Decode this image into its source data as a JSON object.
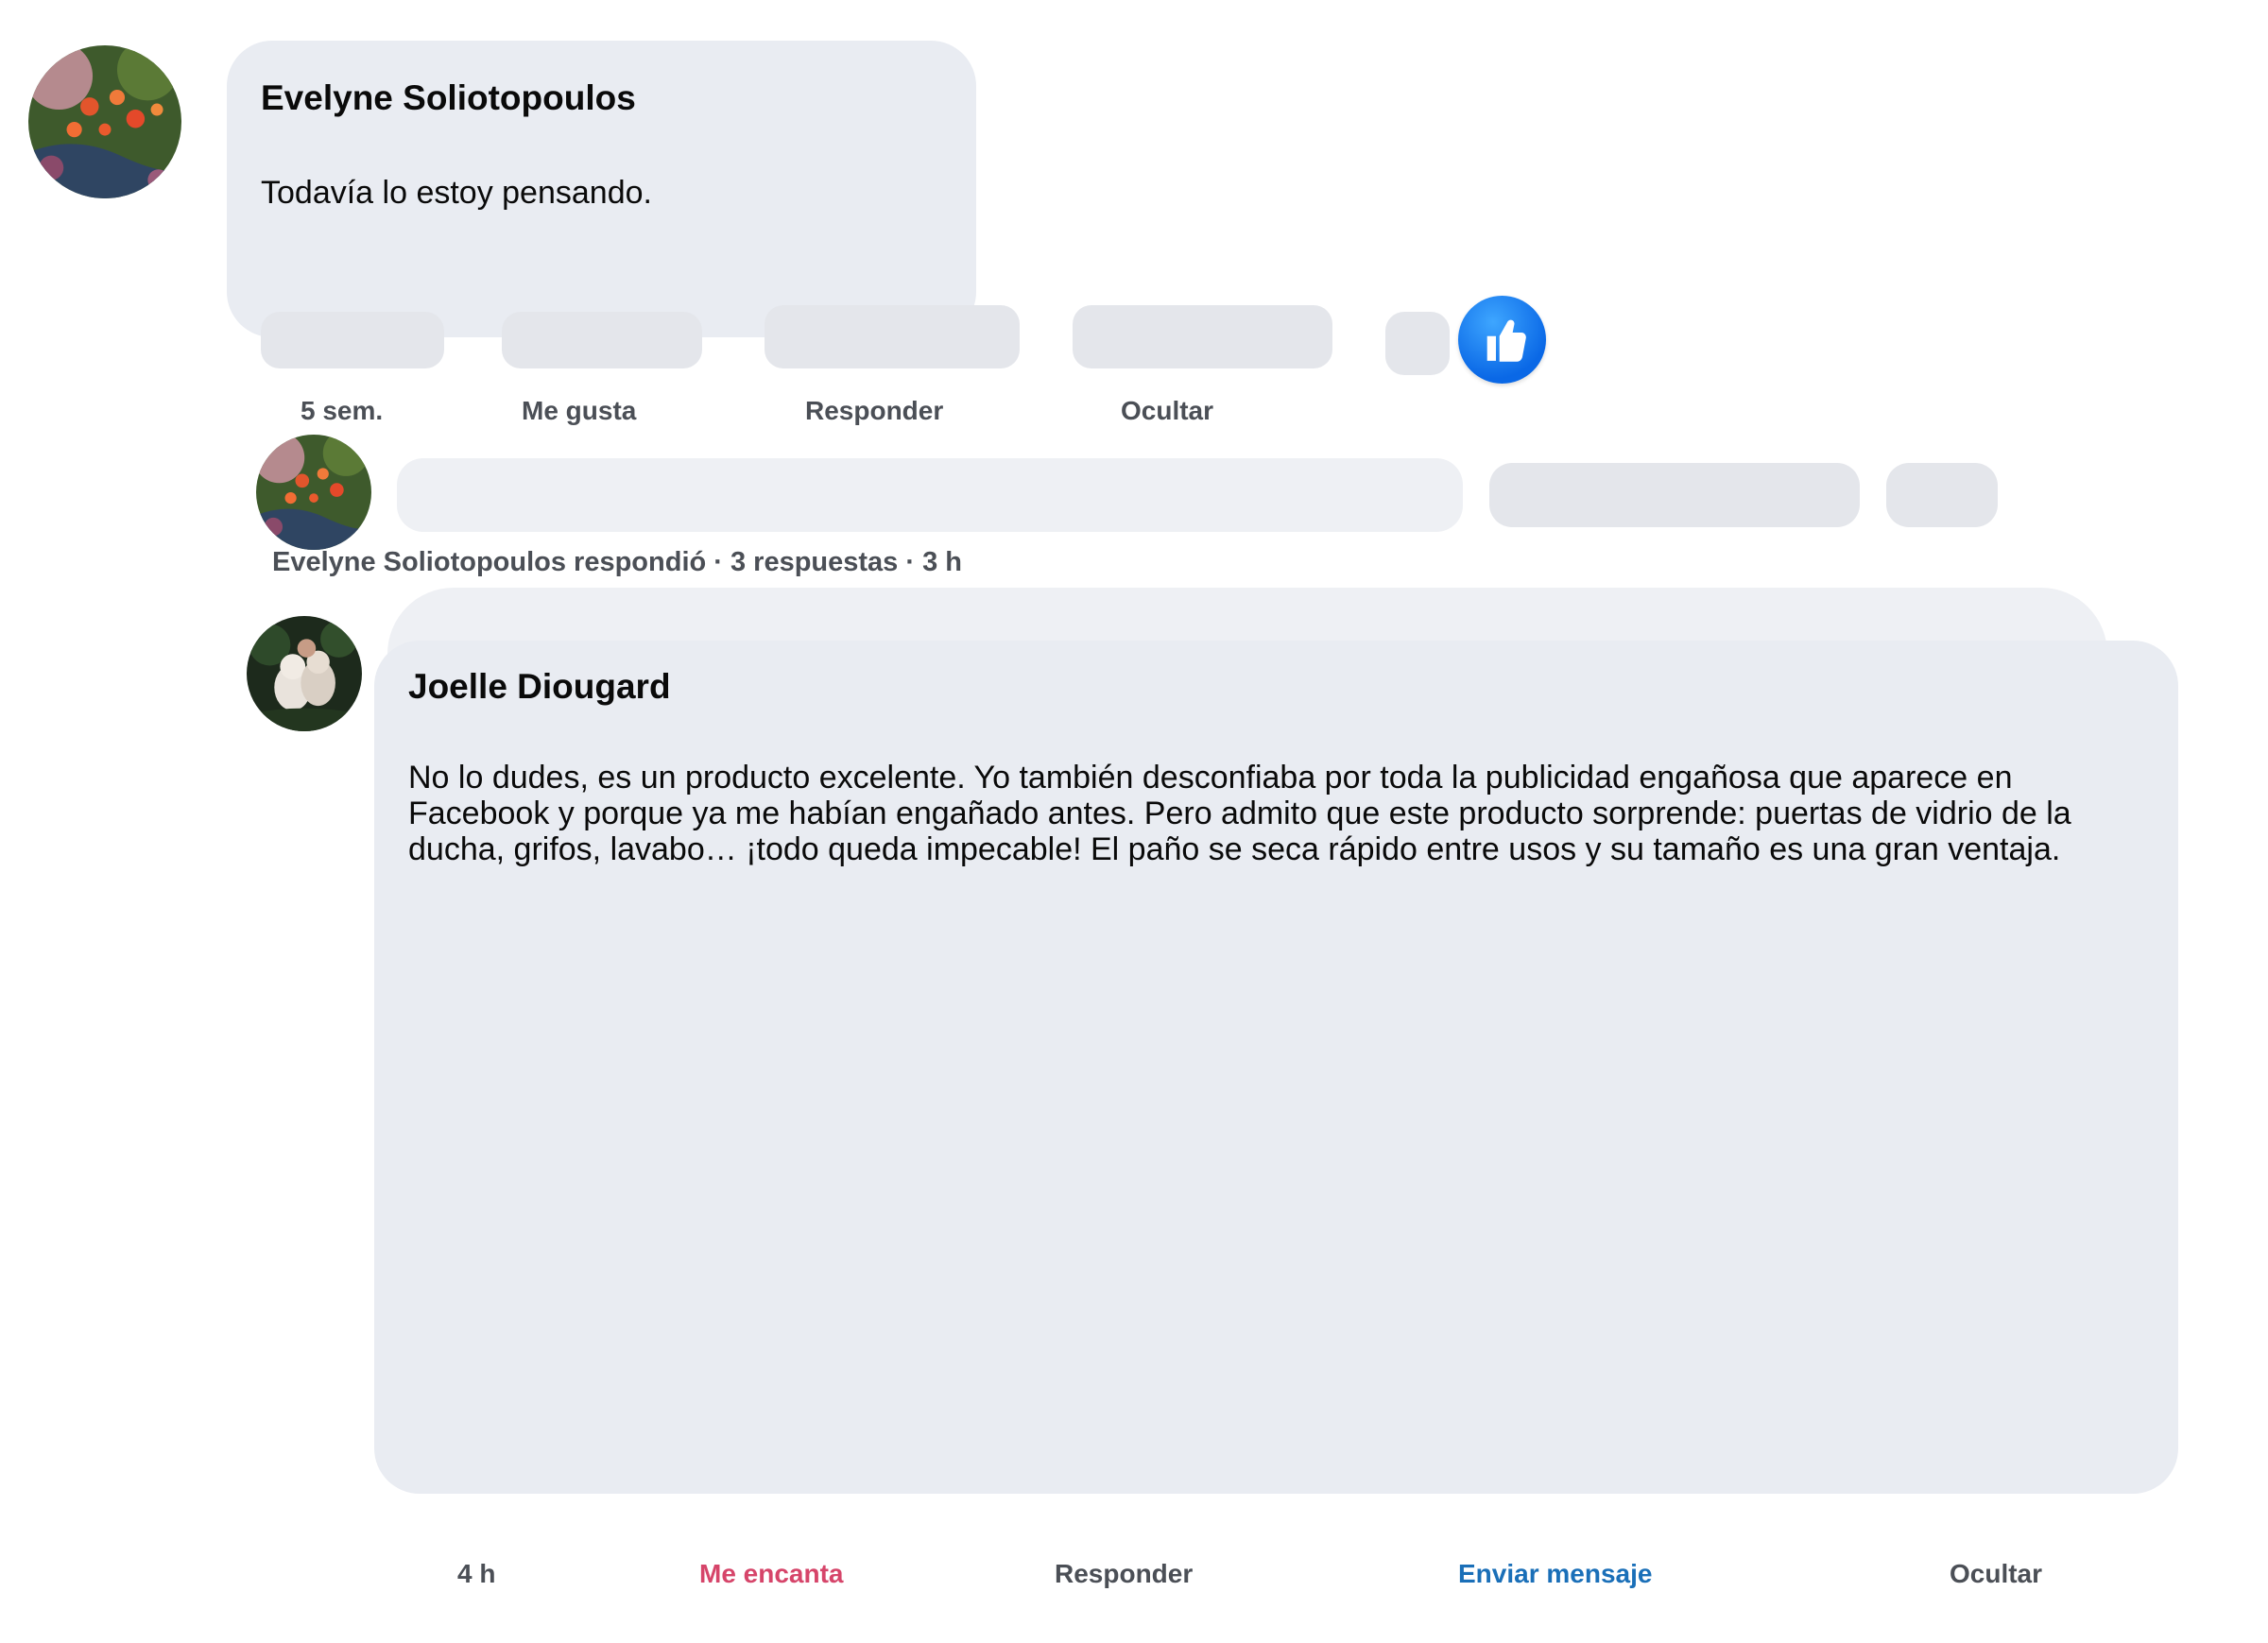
{
  "comment1": {
    "author": "Evelyne Soliotopoulos",
    "text": "Todavía lo estoy pensando.",
    "actions": {
      "time": "5 sem.",
      "like": "Me gusta",
      "reply": "Responder",
      "hide": "Ocultar"
    },
    "replies_summary": "Evelyne Soliotopoulos respondió · 3 respuestas · 3 h"
  },
  "comment2": {
    "author": "Joelle Diougard",
    "text": "No lo dudes, es un producto excelente. Yo también desconfiaba por toda la publicidad engañosa que aparece en Facebook y porque ya me habían engañado antes. Pero admito que este producto sorprende: puertas de vidrio de la ducha, grifos, lavabo… ¡todo queda impecable! El paño se seca rápido entre usos y su tamaño es una gran ventaja.",
    "actions": {
      "time": "4 h",
      "love": "Me encanta",
      "reply": "Responder",
      "message": "Enviar mensaje",
      "hide": "Ocultar"
    }
  },
  "colors": {
    "bubble": "#e9ecf2",
    "skeleton": "#e4e6eb",
    "like_blue": "#0a68e6",
    "love_pink": "#d6456a",
    "message_blue": "#1a6fb8",
    "action_gray": "#4b4f56"
  },
  "icons": {
    "reaction": "thumbs-up-icon"
  }
}
